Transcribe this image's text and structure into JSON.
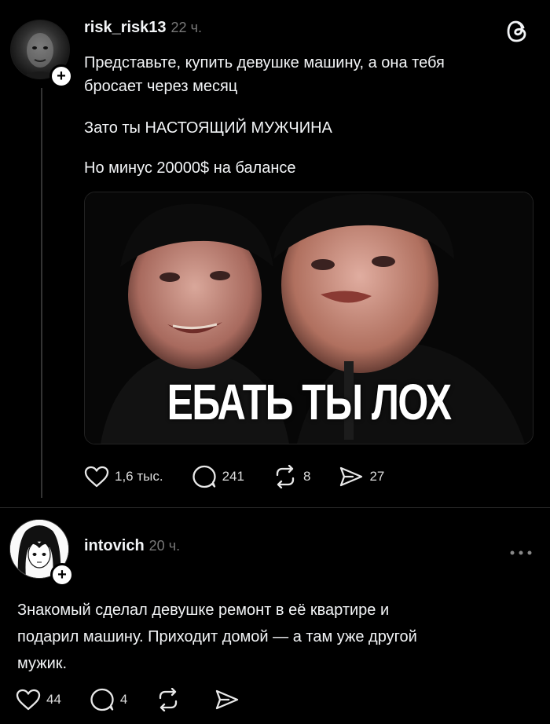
{
  "post1": {
    "username": "risk_risk13",
    "time": "22 ч.",
    "text_line1": "Представьте, купить девушке машину, а она тебя\nбросает через месяц",
    "text_line2": "Зато ты НАСТОЯЩИЙ МУЖЧИНА",
    "text_line3": "Но минус 20000$ на балансе",
    "image_caption": "ЕБАТЬ ТЫ ЛОХ",
    "likes": "1,6 тыс.",
    "comments": "241",
    "reposts": "8",
    "shares": "27"
  },
  "post2": {
    "username": "intovich",
    "time": "20 ч.",
    "text": "Знакомый сделал девушке ремонт в её квартире и\nподарил машину. Приходит домой — а там уже другой\nмужик.",
    "likes": "44",
    "comments": "4"
  },
  "icons": {
    "threads_logo": "threads-logo-icon",
    "plus": "plus-icon",
    "heart": "heart-icon",
    "comment": "comment-icon",
    "repost": "repost-icon",
    "share": "share-icon",
    "more": "more-icon"
  },
  "colors": {
    "background": "#000000",
    "text": "#f3f5f7",
    "muted": "#777777"
  }
}
